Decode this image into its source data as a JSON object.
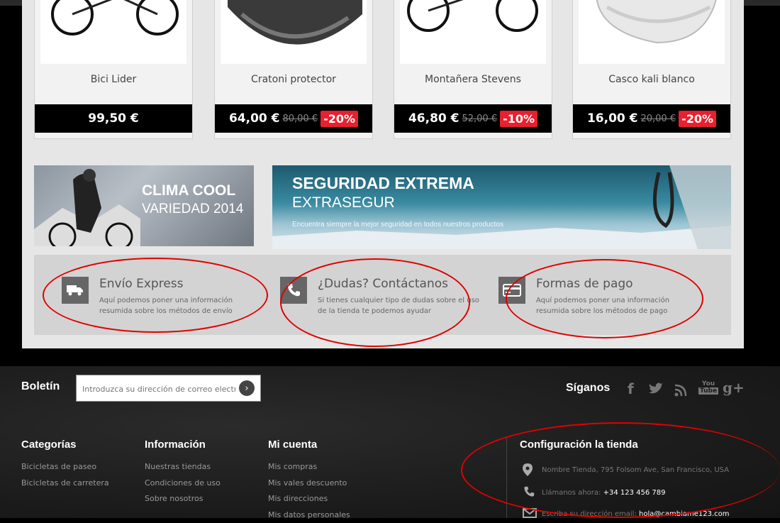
{
  "products": [
    {
      "name": "Bici Lider",
      "price": "99,50 €",
      "old_price": "",
      "discount": ""
    },
    {
      "name": "Cratoni protector",
      "price": "64,00 €",
      "old_price": "80,00 €",
      "discount": "-20%"
    },
    {
      "name": "Montañera Stevens",
      "price": "46,80 €",
      "old_price": "52,00 €",
      "discount": "-10%"
    },
    {
      "name": "Casco kali blanco",
      "price": "16,00 €",
      "old_price": "20,00 €",
      "discount": "-20%"
    }
  ],
  "banners": {
    "left": {
      "line1": "CLIMA COOL",
      "line2": "VARIEDAD 2014"
    },
    "right": {
      "line1": "SEGURIDAD EXTREMA",
      "line2": "EXTRASEGUR",
      "line3": "Encuentra siempre la mejor seguridad en todos nuestros productos"
    }
  },
  "info": [
    {
      "title": "Envío Express",
      "desc": "Aquí podemos poner una información resumida sobre los métodos de envío",
      "icon": "truck-icon"
    },
    {
      "title": "¿Dudas? Contáctanos",
      "desc": "Si tienes cualquier tipo de dudas sobre el uso de la tienda te podemos ayudar",
      "icon": "phone-icon"
    },
    {
      "title": "Formas de pago",
      "desc": "Aquí podemos poner una información resumida sobre los métodos de pago",
      "icon": "credit-card-icon"
    }
  ],
  "footer": {
    "newsletter_label": "Boletín",
    "newsletter_placeholder": "Introduzca su dirección de correo electrónico",
    "social_label": "Síganos",
    "social_icons": [
      "facebook-icon",
      "twitter-icon",
      "rss-icon",
      "youtube-icon",
      "google-plus-icon"
    ],
    "columns": [
      {
        "heading": "Categorías",
        "links": [
          "Bicicletas de paseo",
          "Bicicletas de carretera"
        ]
      },
      {
        "heading": "Información",
        "links": [
          "Nuestras tiendas",
          "Condiciones de uso",
          "Sobre nosotros"
        ]
      },
      {
        "heading": "Mi cuenta",
        "links": [
          "Mis compras",
          "Mis vales descuento",
          "Mis direcciones",
          "Mis datos personales"
        ]
      }
    ],
    "store": {
      "heading": "Configuración la tienda",
      "address": "Nombre Tienda, 795 Folsom Ave, San Francisco, USA",
      "phone_label": "Llámanos ahora:",
      "phone": "+34 123 456 789",
      "email_label": "Escriba su dirección email:",
      "email": "hola@cambiame123.com"
    }
  },
  "colors": {
    "accent": "#e8202f",
    "annotation": "#e10000",
    "panel": "#e6e6e6"
  }
}
